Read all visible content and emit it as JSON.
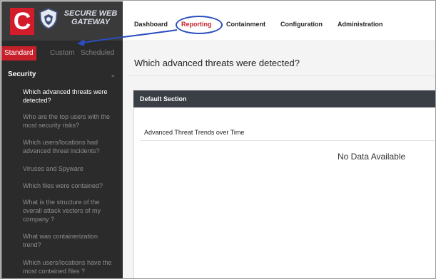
{
  "brand": {
    "logo_letter": "C",
    "name_line1": "SECURE WEB",
    "name_line2": "GATEWAY",
    "icon": "shield-logo-icon"
  },
  "nav": {
    "items": [
      "Dashboard",
      "Reporting",
      "Containment",
      "Configuration",
      "Administration"
    ],
    "active": "Reporting"
  },
  "report_tabs": {
    "items": [
      "Standard",
      "Custom",
      "Scheduled"
    ],
    "active": "Standard"
  },
  "sidebar": {
    "section": "Security",
    "section_icon": "chevron-down-icon",
    "items": [
      "Which advanced threats were detected?",
      "Who are the top users with the most security risks?",
      "Which users/locations had advanced threat incidents?",
      "Viruses and Spyware",
      "Which files were contained?",
      "What is the structure of the overall attack vectors of my company ?",
      "What was containerization trend?",
      "Which users/locations have the most contained files ?"
    ]
  },
  "main": {
    "page_title": "Which advanced threats were detected?",
    "section_title": "Default Section",
    "card_title": "Advanced Threat Trends over Time",
    "empty_message": "No Data Available"
  },
  "colors": {
    "accent": "#c8202b",
    "annotation": "#2a4dbf",
    "sidebar_bg": "#2b2b2b",
    "panel_header": "#3a3f45"
  }
}
